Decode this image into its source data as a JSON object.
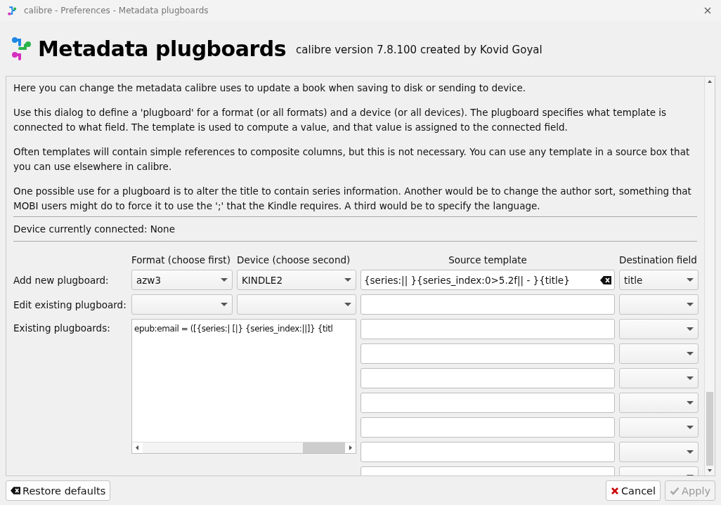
{
  "window": {
    "title": "calibre - Preferences - Metadata plugboards"
  },
  "header": {
    "title": "Metadata plugboards",
    "subtitle": "calibre version 7.8.100 created by Kovid Goyal"
  },
  "description": [
    "Here you can change the metadata calibre uses to update a book when saving to disk or sending to device.",
    "Use this dialog to define a 'plugboard' for a format (or all formats) and a device (or all devices). The plugboard specifies what template is connected to what field. The template is used to compute a value, and that value is assigned to the connected field.",
    "Often templates will contain simple references to composite columns, but this is not necessary. You can use any template in a source box that you can use elsewhere in calibre.",
    "One possible use for a plugboard is to alter the title to contain series information. Another would be to change the author sort, something that MOBI users might do to force it to use the ';' that the Kindle requires. A third would be to specify the language."
  ],
  "device_status": "Device currently connected: None",
  "columns": [
    "Format (choose first)",
    "Device (choose second)",
    "Source template",
    "Destination field"
  ],
  "add_new": {
    "label": "Add new plugboard:",
    "format": "azw3",
    "device": "KINDLE2",
    "template": "{series:|| }{series_index:0>5.2f|| - }{title}",
    "destination": "title"
  },
  "edit_existing": {
    "label": "Edit existing plugboard:"
  },
  "existing": {
    "label": "Existing plugboards:",
    "items": [
      "epub:email = ([{series:| [|} {series_index:||]} {titl"
    ]
  },
  "extra_rows": [
    {
      "kind": "mapping"
    },
    {
      "kind": "mapping"
    },
    {
      "kind": "mapping"
    },
    {
      "kind": "mapping"
    },
    {
      "kind": "mapping"
    },
    {
      "kind": "mapping"
    }
  ],
  "footer": {
    "restore": "Restore defaults",
    "cancel": "Cancel",
    "apply": {
      "label": "Apply",
      "disabled": true
    }
  }
}
